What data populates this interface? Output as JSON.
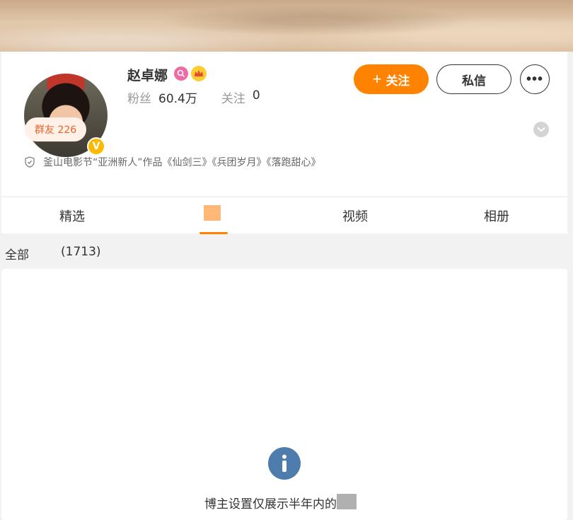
{
  "profile": {
    "username": "赵卓娜",
    "verified_glyph": "V",
    "stats": {
      "fans_label": "粉丝",
      "fans_value": "60.4万",
      "following_label": "关注",
      "following_value": "0"
    },
    "follow_plus": "+",
    "follow_label": "关注",
    "message_label": "私信",
    "more_label": "•••",
    "group_badge": "群友 226",
    "bio": "釜山电影节“亚洲新人”作品《仙剑三》《兵团岁月》《落跑甜心》"
  },
  "tabs": {
    "featured": "精选",
    "video": "视频",
    "album": "相册"
  },
  "filter": {
    "label": "全部",
    "count": "(1713)"
  },
  "notice": {
    "text": "博主设置仅展示半年内的"
  },
  "colors": {
    "accent": "#ff8200",
    "info": "#4d7cad",
    "group_badge_text": "#e8642b"
  }
}
